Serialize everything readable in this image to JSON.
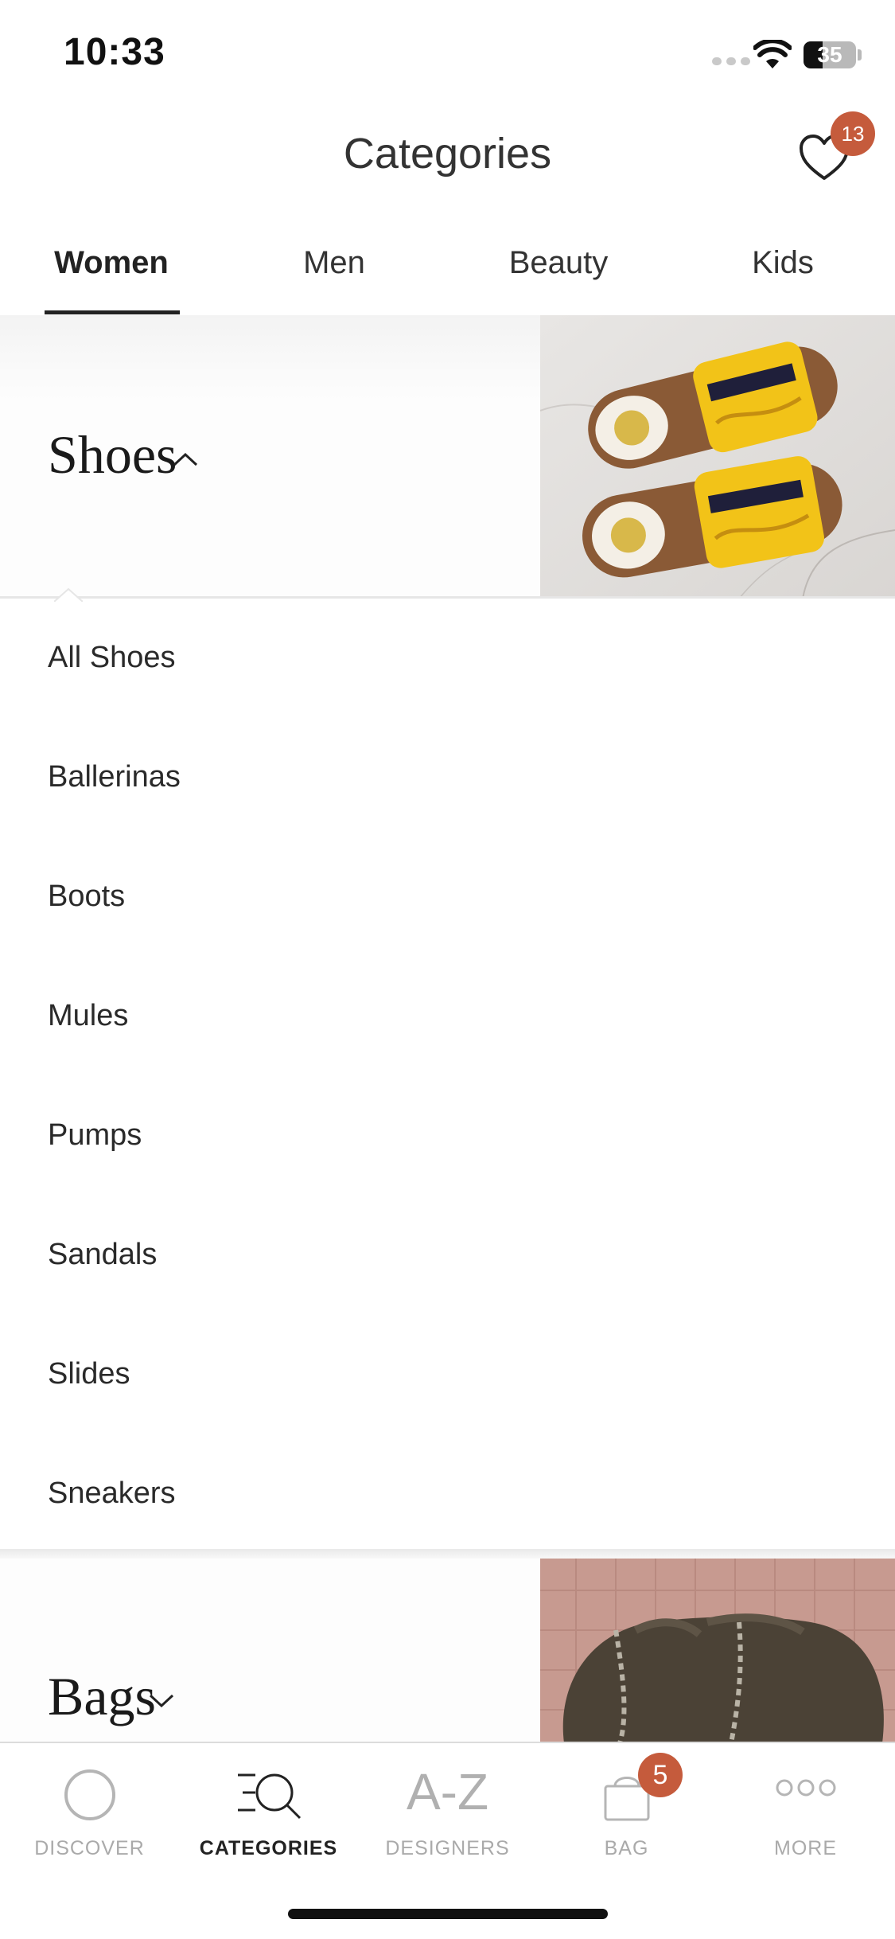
{
  "status_bar": {
    "time": "10:33",
    "battery": "35"
  },
  "header": {
    "title": "Categories",
    "wishlist_count": "13"
  },
  "tabs": [
    {
      "label": "Women",
      "active": true
    },
    {
      "label": "Men",
      "active": false
    },
    {
      "label": "Beauty",
      "active": false
    },
    {
      "label": "Kids",
      "active": false
    }
  ],
  "sections": {
    "shoes": {
      "title": "Shoes",
      "expanded": true,
      "items": [
        "All Shoes",
        "Ballerinas",
        "Boots",
        "Mules",
        "Pumps",
        "Sandals",
        "Slides",
        "Sneakers"
      ]
    },
    "bags": {
      "title": "Bags",
      "expanded": false
    }
  },
  "bottom_nav": {
    "items": [
      {
        "label": "DISCOVER",
        "icon": "discover-icon"
      },
      {
        "label": "CATEGORIES",
        "icon": "categories-icon",
        "active": true
      },
      {
        "label": "DESIGNERS",
        "icon": "a-z-icon",
        "icon_text": "A-Z"
      },
      {
        "label": "BAG",
        "icon": "bag-icon"
      },
      {
        "label": "MORE",
        "icon": "more-icon"
      }
    ],
    "bag_count": "5"
  },
  "colors": {
    "badge": "#c55b3c",
    "active_text": "#222222",
    "inactive_nav": "#aaaaaa"
  }
}
